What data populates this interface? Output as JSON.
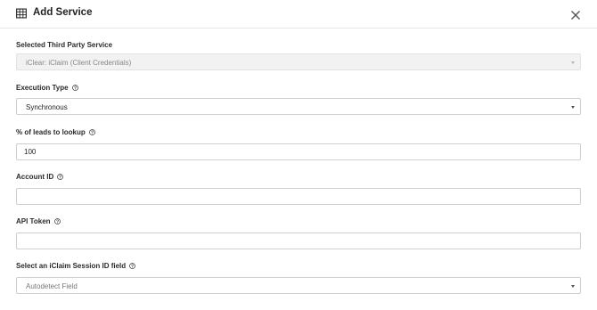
{
  "modal": {
    "title": "Add Service",
    "title_icon": "table-icon",
    "close_icon": "close-icon"
  },
  "fields": {
    "third_party": {
      "label": "Selected Third Party Service",
      "value": "iClear: iClaim (Client Credentials)"
    },
    "execution_type": {
      "label": "Execution Type",
      "value": "Synchronous"
    },
    "leads_percent": {
      "label": "% of leads to lookup",
      "value": "100"
    },
    "account_id": {
      "label": "Account ID",
      "value": ""
    },
    "api_token": {
      "label": "API Token",
      "value": ""
    },
    "session_field": {
      "label": "Select an iClaim Session ID field",
      "value": "Autodetect Field"
    }
  },
  "icons": {
    "help": "help-circle-icon"
  }
}
